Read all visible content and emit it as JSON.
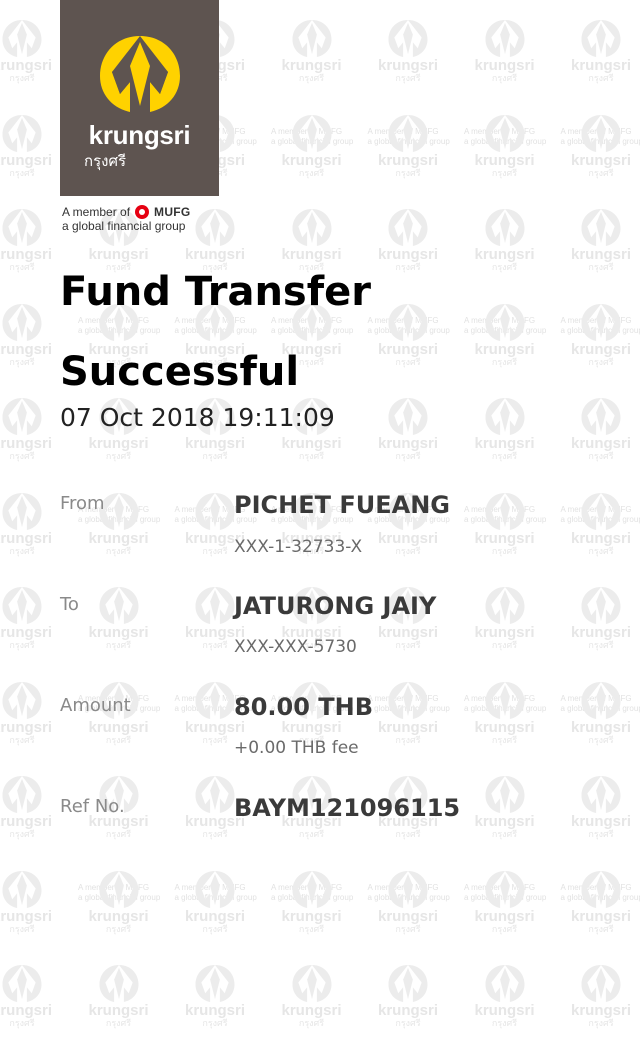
{
  "brand": {
    "name_en": "krungsri",
    "name_th": "กรุงศรี",
    "member_line1": "A member of",
    "mufg": "MUFG",
    "member_line2": "a global financial group",
    "logo_bg": "#5e5450",
    "logo_accent": "#ffd200"
  },
  "receipt": {
    "title_line1": "Fund Transfer",
    "title_line2": "Successful",
    "datetime": "07 Oct 2018 19:11:09",
    "from_label": "From",
    "from_name": "PICHET FUEANG",
    "from_account": "XXX-1-32733-X",
    "to_label": "To",
    "to_name": "JATURONG JAIY",
    "to_account": "XXX-XXX-5730",
    "amount_label": "Amount",
    "amount": "80.00 THB",
    "fee": "+0.00 THB fee",
    "ref_label": "Ref No.",
    "ref": "BAYM121096115"
  }
}
